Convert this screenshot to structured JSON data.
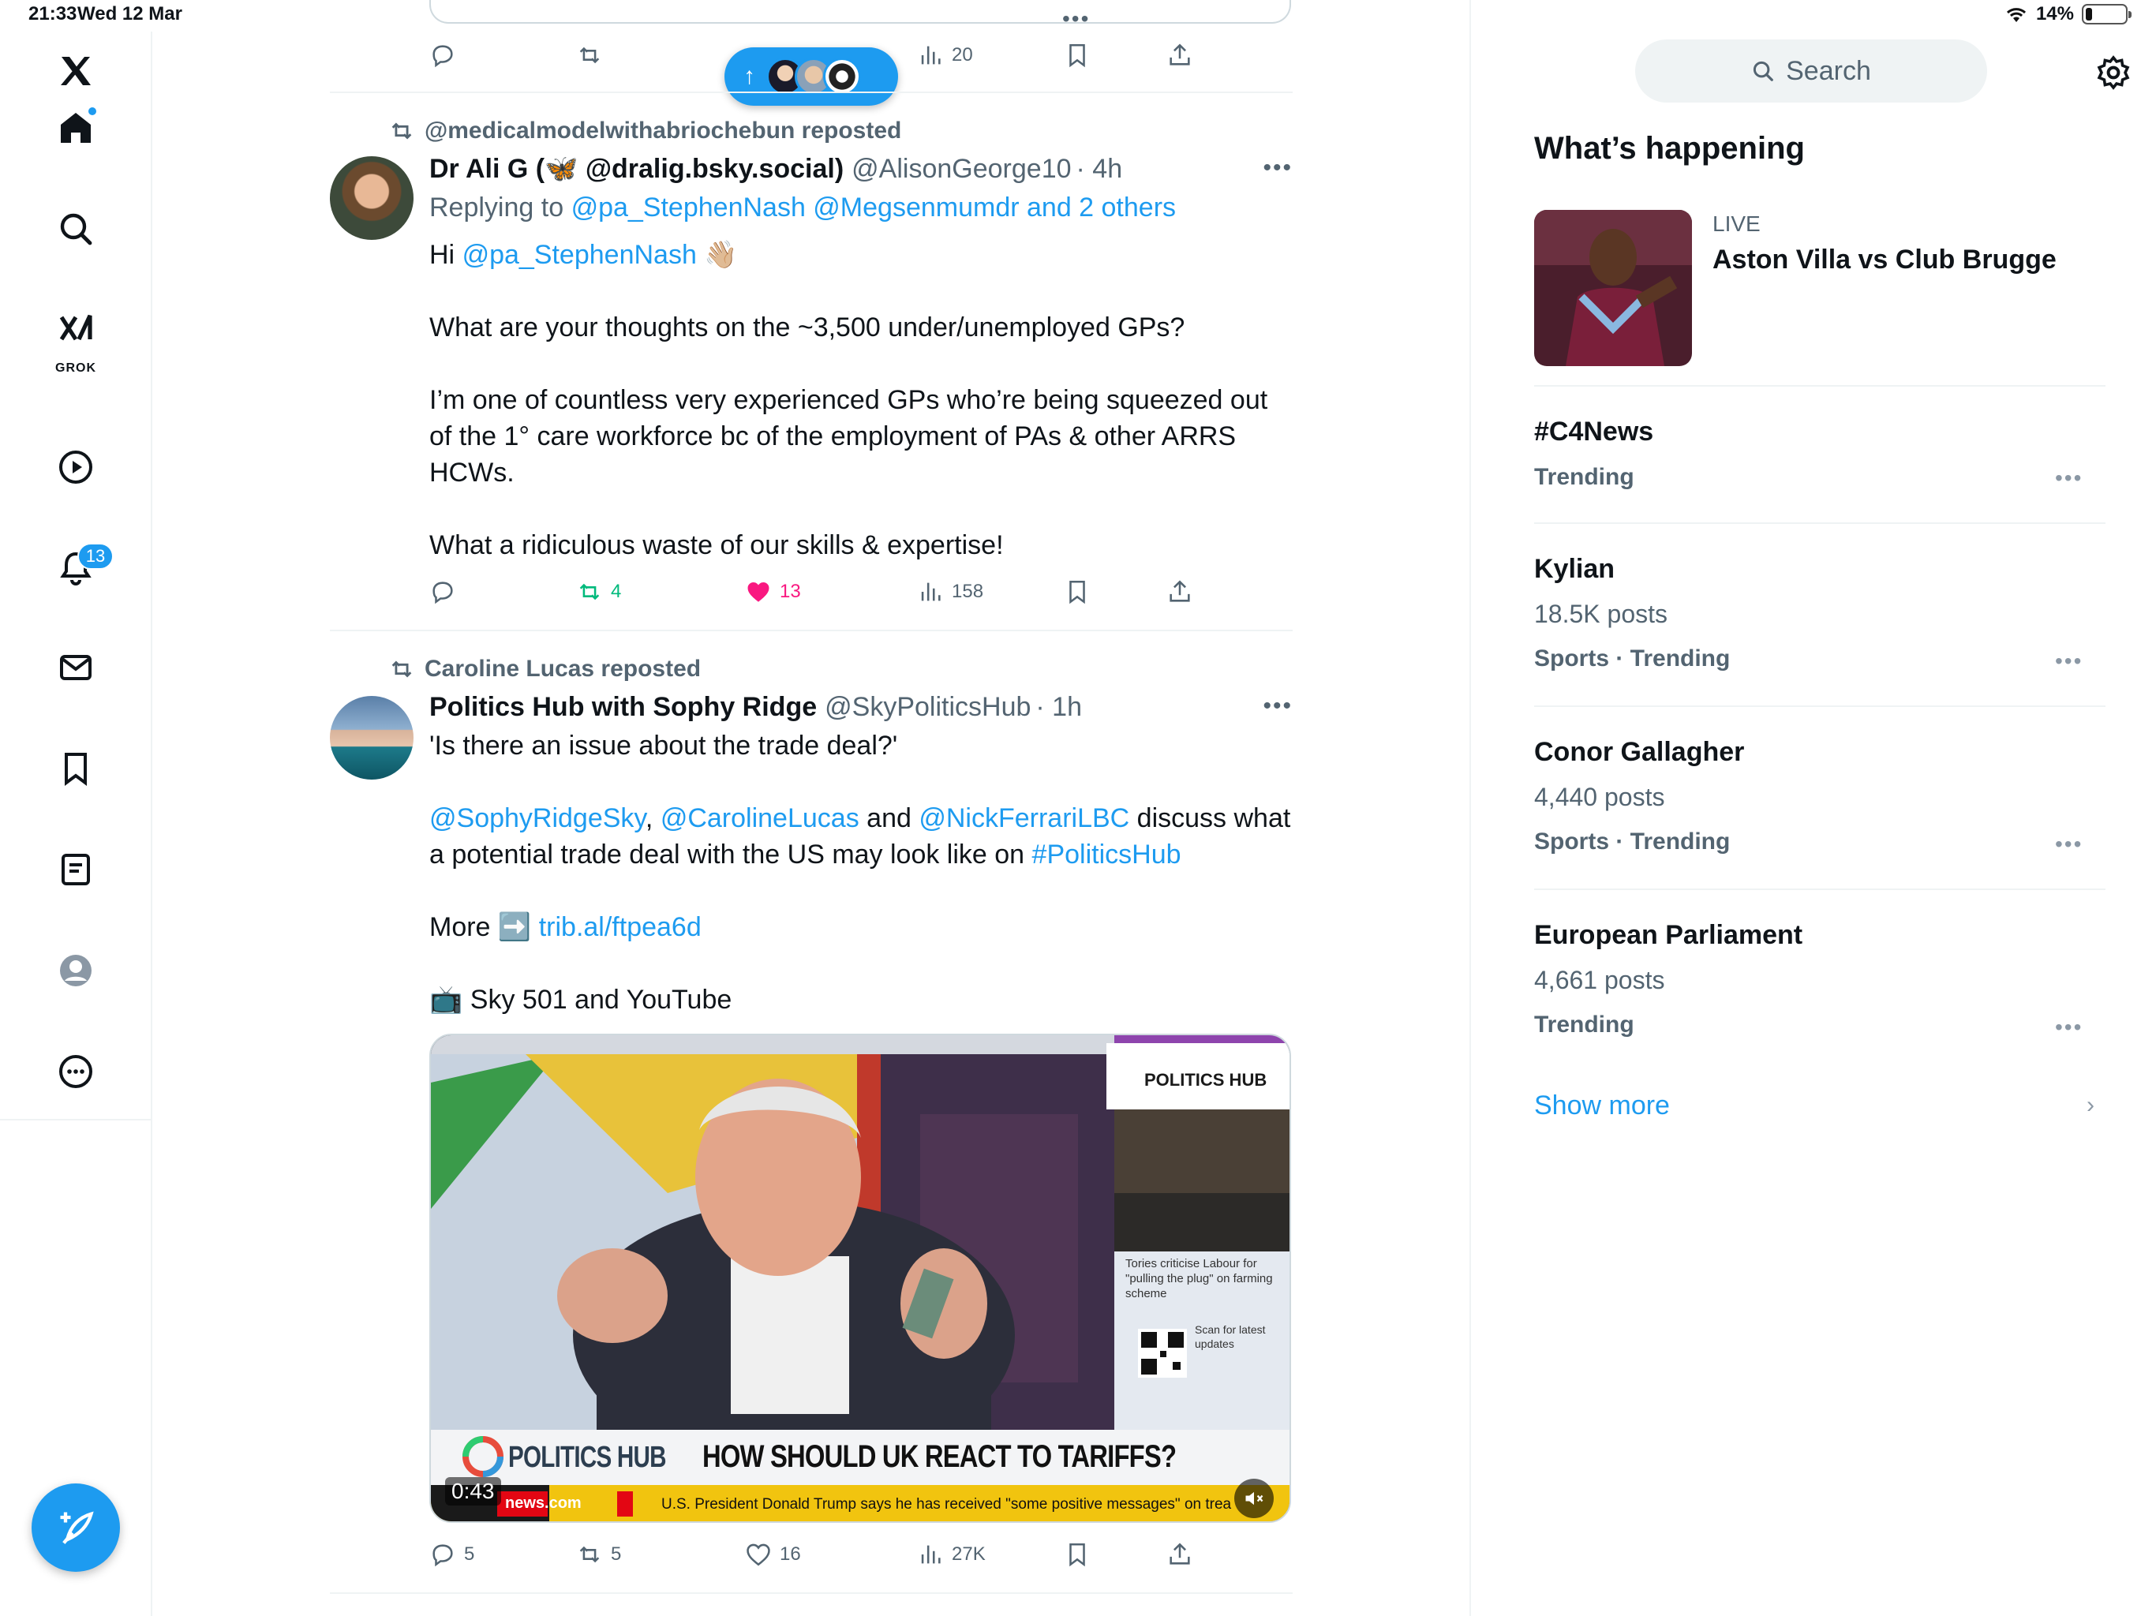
{
  "status_bar": {
    "time": "21:33",
    "date": "Wed 12 Mar",
    "battery": "14%"
  },
  "nav": {
    "notifications_badge": "13",
    "grok_label": "GROK"
  },
  "prev_post": {
    "views": "20"
  },
  "new_posts_button": {
    "arrow": "↑"
  },
  "post1": {
    "repost_label": "@medicalmodelwithabriochebun reposted",
    "name": "Dr Ali G (🦋 @dralig.bsky.social)",
    "handle": "@AlisonGeorge10",
    "time": "· 4h",
    "replying_prefix": "Replying to",
    "replying_to": "@pa_StephenNash @Megsenmumdr and 2 others",
    "greeting": "Hi",
    "greeting_mention": "@pa_StephenNash",
    "greeting_emoji": "👋🏼",
    "para1": "What are your thoughts on the ~3,500 under/unemployed GPs?",
    "para2": "I’m one of countless very experienced GPs who’re being squeezed out of the 1° care workforce bc of the employment of PAs & other ARRS HCWs.",
    "para3": "What a ridiculous waste of our skills & expertise!",
    "reposts": "4",
    "likes": "13",
    "views": "158"
  },
  "post2": {
    "repost_label": "Caroline Lucas reposted",
    "name": "Politics Hub with Sophy Ridge",
    "handle": "@SkyPoliticsHub",
    "time": "· 1h",
    "line1": "'Is there an issue about the trade deal?'",
    "mention1": "@SophyRidgeSky",
    "sep1": ",",
    "mention2": "@CarolineLucas",
    "and": "and",
    "mention3": "@NickFerrariLBC",
    "line2_rest": "discuss what a potential trade deal with the US may look like on",
    "hashtag": "#PoliticsHub",
    "more_label": "More",
    "more_emoji": "➡️",
    "more_link": "trib.al/ftpea6d",
    "tv_emoji": "📺",
    "tv_line": "Sky 501 and YouTube",
    "video": {
      "side_logo": "POLITICS HUB",
      "side_caption": "Tories criticise Labour for \"pulling the plug\" on farming scheme",
      "qr_caption": "Scan for latest updates",
      "lower_logo": "POLITICS HUB",
      "headline": "HOW SHOULD UK REACT TO TARIFFS?",
      "time": "0:43",
      "site": "news.com",
      "ticker": "U.S. President Donald Trump says he has received \"some positive messages\" on trea"
    },
    "replies": "5",
    "reposts": "5",
    "likes": "16",
    "views": "27K"
  },
  "sidebar": {
    "search_placeholder": "Search",
    "title": "What’s happening",
    "live": {
      "tag": "LIVE",
      "title": "Aston Villa vs Club Brugge"
    },
    "trends": [
      {
        "topic": "#C4News",
        "posts": "",
        "meta": "Trending"
      },
      {
        "topic": "Kylian",
        "posts": "18.5K posts",
        "meta": "Sports · Trending"
      },
      {
        "topic": "Conor Gallagher",
        "posts": "4,440 posts",
        "meta": "Sports · Trending"
      },
      {
        "topic": "European Parliament",
        "posts": "4,661 posts",
        "meta": "Trending"
      }
    ],
    "show_more": "Show more"
  },
  "colors": {
    "accent": "#1d9bf0",
    "like": "#f91880",
    "repost": "#00ba7c",
    "muted": "#536471"
  }
}
